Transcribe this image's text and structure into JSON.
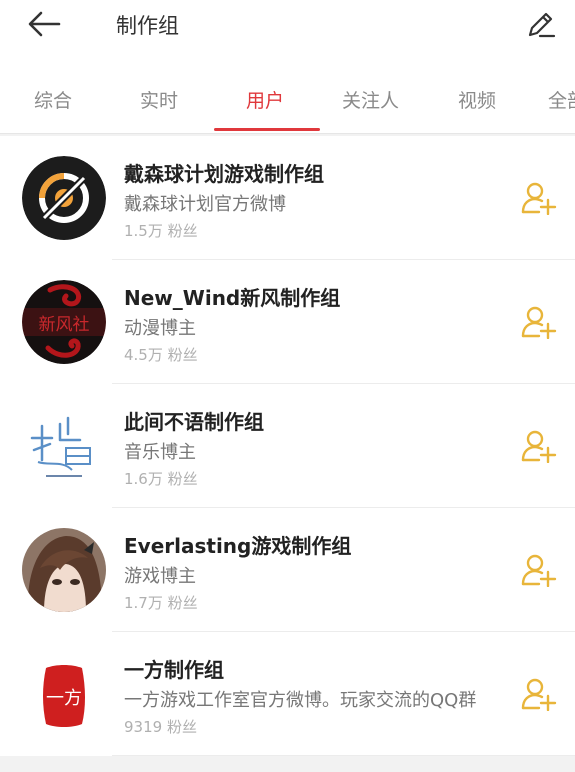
{
  "header": {
    "query": "制作组",
    "back_icon": "back-arrow-icon",
    "edit_icon": "pencil-icon"
  },
  "tabs": [
    {
      "label": "综合",
      "active": false
    },
    {
      "label": "实时",
      "active": false
    },
    {
      "label": "用户",
      "active": true
    },
    {
      "label": "关注人",
      "active": false
    },
    {
      "label": "视频",
      "active": false
    },
    {
      "label": "全部",
      "active": false
    }
  ],
  "colors": {
    "accent": "#e0383c",
    "follow": "#e8b53a"
  },
  "users": [
    {
      "name": "戴森球计划游戏制作组",
      "desc": "戴森球计划官方微博",
      "fans": "1.5万 粉丝",
      "avatar_icon": "dyson-sphere-logo-icon"
    },
    {
      "name": "New_Wind新风制作组",
      "desc": "动漫博主",
      "fans": "4.5万 粉丝",
      "avatar_icon": "new-wind-logo-icon",
      "avatar_text": "新风社"
    },
    {
      "name": "此间不语制作组",
      "desc": "音乐博主",
      "fans": "1.6万 粉丝",
      "avatar_icon": "calligraphy-logo-icon"
    },
    {
      "name": "Everlasting游戏制作组",
      "desc": "游戏博主",
      "fans": "1.7万 粉丝",
      "avatar_icon": "anime-girl-avatar-icon"
    },
    {
      "name": "一方制作组",
      "desc": "一方游戏工作室官方微博。玩家交流的QQ群",
      "fans": "9319 粉丝",
      "avatar_icon": "red-seal-logo-icon",
      "avatar_text": "一方"
    }
  ]
}
